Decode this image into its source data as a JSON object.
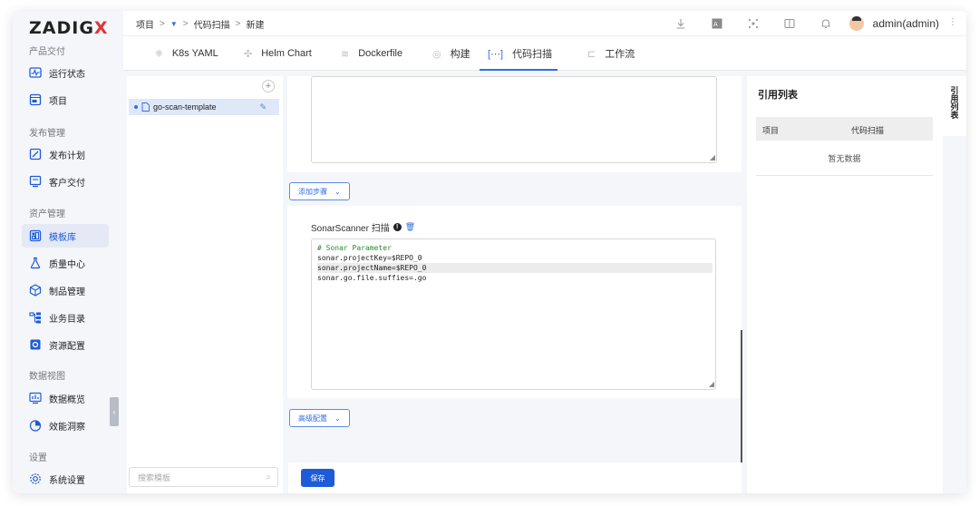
{
  "logo": {
    "text_left": "ZADIG",
    "text_x": "X"
  },
  "sidebar": {
    "sections": [
      {
        "label": "产品交付"
      },
      {
        "label": "发布管理"
      },
      {
        "label": "资产管理"
      },
      {
        "label": "数据视图"
      },
      {
        "label": "设置"
      }
    ],
    "items": [
      {
        "label": "运行状态",
        "icon": "pulse-icon"
      },
      {
        "label": "项目",
        "icon": "project-icon"
      },
      {
        "label": "发布计划",
        "icon": "release-plan-icon"
      },
      {
        "label": "客户交付",
        "icon": "delivery-icon"
      },
      {
        "label": "模板库",
        "icon": "template-icon",
        "active": true
      },
      {
        "label": "质量中心",
        "icon": "flask-icon"
      },
      {
        "label": "制品管理",
        "icon": "artifact-icon"
      },
      {
        "label": "业务目录",
        "icon": "catalog-icon"
      },
      {
        "label": "资源配置",
        "icon": "gear-box-icon"
      },
      {
        "label": "数据概览",
        "icon": "chart-icon"
      },
      {
        "label": "效能洞察",
        "icon": "pie-icon"
      },
      {
        "label": "系统设置",
        "icon": "settings-icon"
      }
    ]
  },
  "breadcrumb": {
    "root": "项目",
    "sep": ">",
    "current_section": "代码扫描",
    "page": "新建"
  },
  "header": {
    "user": "admin(admin)"
  },
  "tabs": [
    {
      "label": "K8s YAML",
      "icon": "k8s-icon"
    },
    {
      "label": "Helm Chart",
      "icon": "helm-icon"
    },
    {
      "label": "Dockerfile",
      "icon": "docker-icon"
    },
    {
      "label": "构建",
      "icon": "build-icon"
    },
    {
      "label": "代码扫描",
      "icon": "scan-icon",
      "active": true
    },
    {
      "label": "工作流",
      "icon": "workflow-icon"
    }
  ],
  "templates": {
    "items": [
      {
        "name": "go-scan-template"
      }
    ],
    "search_placeholder": "搜索模板"
  },
  "editor": {
    "add_step_label": "添加步骤",
    "step_title": "SonarScanner 扫描",
    "code_lines": [
      "# Sonar Parameter",
      "sonar.projectKey=$REPO_0",
      "sonar.projectName=$REPO_0",
      "sonar.go.file.suffies=.go"
    ],
    "advanced_label": "高级配置",
    "save_label": "保存"
  },
  "reference": {
    "title": "引用列表",
    "columns": [
      "项目",
      "代码扫描"
    ],
    "empty_text": "暂无数据",
    "side_tab": [
      "引",
      "用",
      "列",
      "表"
    ]
  },
  "colors": {
    "accent": "#1e5bd8",
    "brand_x": "#e0343a"
  }
}
